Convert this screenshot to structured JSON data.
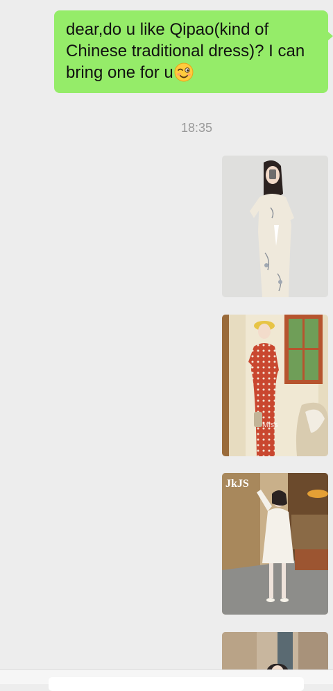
{
  "chat": {
    "messages": [
      {
        "text": "dear,do u like Qipao(kind of Chinese traditional dress)? I can bring one for u",
        "emoji": "smiling-winking-face-icon"
      }
    ],
    "timestamp": "18:35",
    "photos": [
      {
        "name": "qipao-photo-white-floral"
      },
      {
        "name": "qipao-photo-red-polka-dot"
      },
      {
        "name": "qipao-photo-white-short",
        "watermark": "JkJS"
      },
      {
        "name": "qipao-photo-partial"
      }
    ]
  },
  "colors": {
    "background": "#ededed",
    "sent_bubble": "#95ec69",
    "timestamp_text": "#999999"
  }
}
